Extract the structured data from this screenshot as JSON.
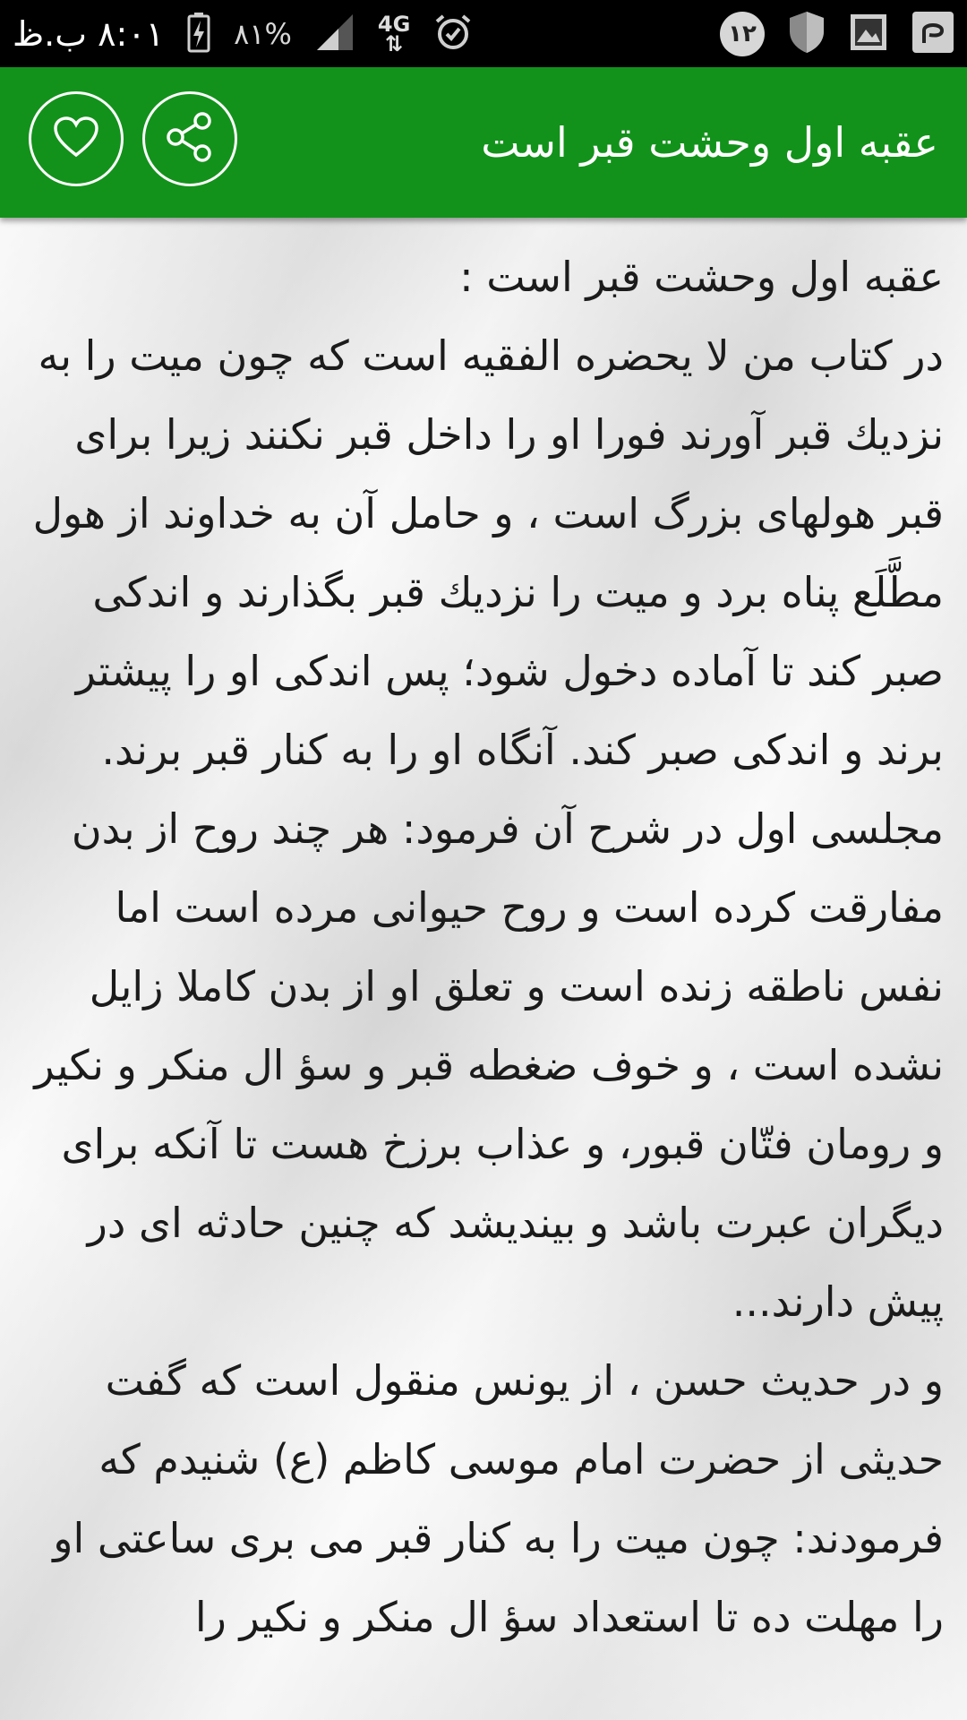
{
  "status_bar": {
    "time": "۸:۰۱ ب.ظ",
    "battery_percent": "۸۱%",
    "network_type": "4G",
    "notification_count": "۱۲",
    "icons": [
      "battery-charging-icon",
      "signal-icon",
      "network-arrows-icon",
      "alarm-icon",
      "notification-badge",
      "shield-icon",
      "gallery-icon",
      "app-notification-icon"
    ]
  },
  "app_bar": {
    "title": "عقبه اول وحشت قبر است",
    "share_icon": "share-icon",
    "favorite_icon": "heart-icon",
    "color": "#12921a"
  },
  "article": {
    "text": "عقبه اول وحشت قبر است :\nدر کتاب من لا يحضره الفقيه است که چون میت را به نزديك قبر آورند فورا او را داخل قبر نکنند زيرا براى قبر هولهاى بزرگ است ، و حامل آن به خداوند از هول مطَّلَع پناه برد و میت را نزديك قبر بگذارند و اندكى صبر كند تا آماده دخول شود؛ پس اندكى او را پيشتر برند و اندکی صبر كند. آنگاه او را به كنار قبر برند.\nمجلسى اول در شرح آن فرمود: هر چند روح از بدن مفارقت كرده است و روح حيوانى مرده است اما نفس ناطقه زنده است و تعلق او از بدن كاملا زايل نشده است ، و خوف ضغطه قبر و سؤ ال منكر و نكير و رومان فتّان قبور، و عذاب برزخ هست تا آنكه براى ديگران عبرت باشد و بينديشد كه چنين حادثه اى در پيش دارند...\nو در حديث حسن ، از يونس منقول است كه گفت حديثى از حضرت امام موسى كاظم (ع) شنيدم كه فرمودند: چون ميت را به كنار قبر مى برى ساعتى او را مهلت ده تا استعداد سؤ ال منكر و نكير را"
  }
}
